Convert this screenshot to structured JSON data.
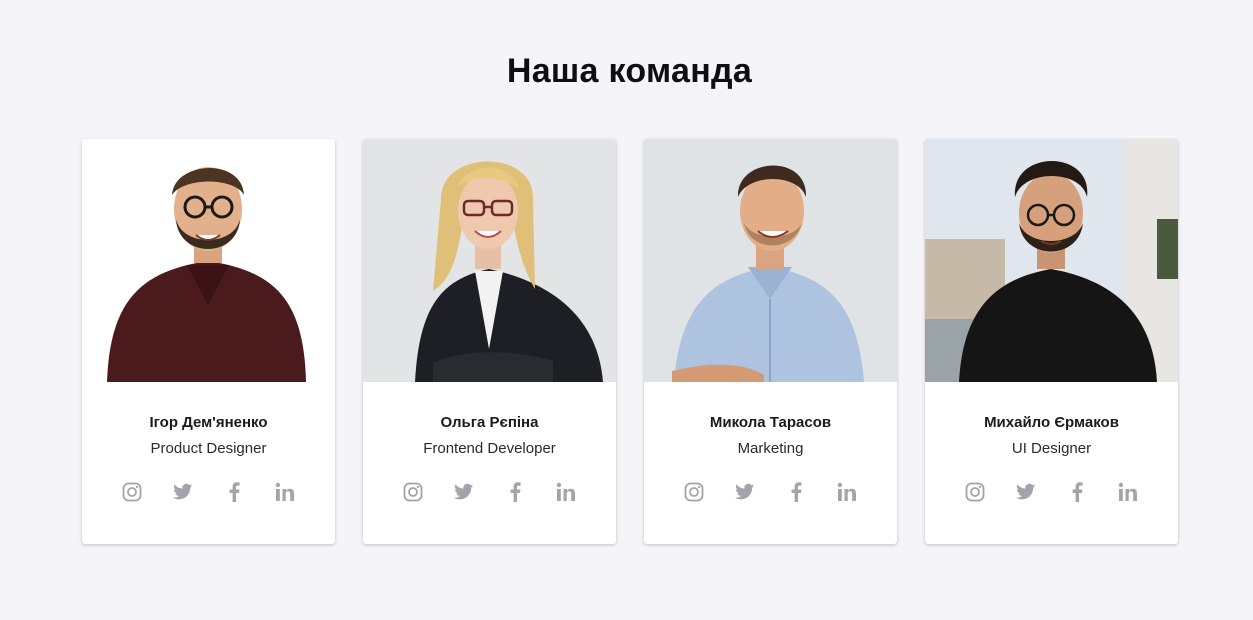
{
  "section": {
    "title": "Наша команда"
  },
  "team": [
    {
      "name": "Ігор Дем'яненко",
      "role": "Product Designer"
    },
    {
      "name": "Ольга Рєпіна",
      "role": "Frontend Developer"
    },
    {
      "name": "Микола Тарасов",
      "role": "Marketing"
    },
    {
      "name": "Михайло Єрмаков",
      "role": "UI Designer"
    }
  ],
  "social_icons": [
    "instagram-icon",
    "twitter-icon",
    "facebook-icon",
    "linkedin-icon"
  ],
  "colors": {
    "page_background": "#f4f4f9",
    "card_background": "#ffffff",
    "icon_color": "#a3a3ab",
    "title_color": "#0f0f12"
  }
}
